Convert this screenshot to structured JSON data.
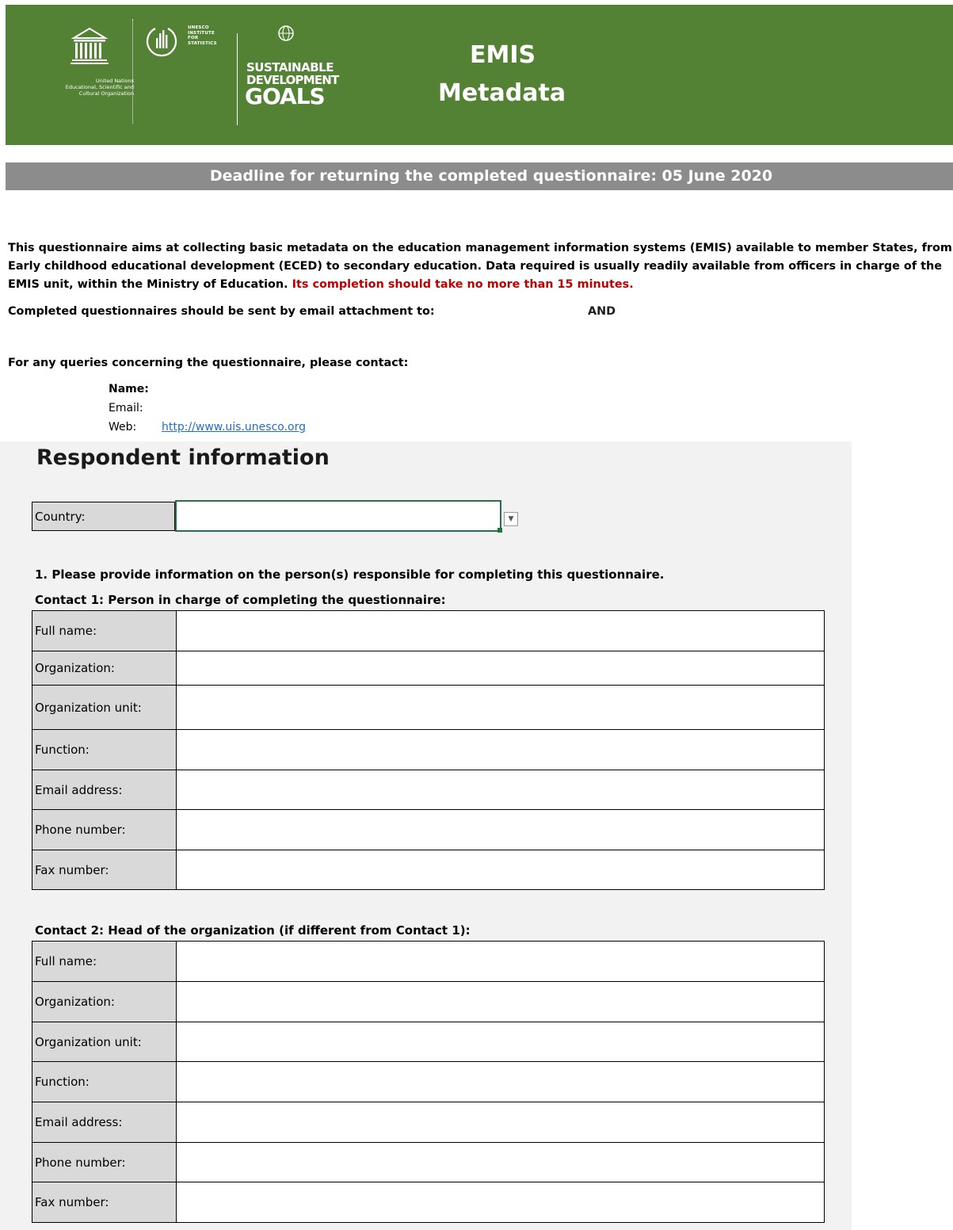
{
  "header": {
    "unesco_org_text": [
      "United Nations",
      "Educational, Scientific and",
      "Cultural Organization"
    ],
    "uis_text": [
      "UNESCO",
      "INSTITUTE",
      "FOR",
      "STATISTICS"
    ],
    "sdg_text": [
      "SUSTAINABLE",
      "DEVELOPMENT",
      "GOALS"
    ],
    "title_line1": "EMIS",
    "title_line2": "Metadata",
    "brand_color": "#548235"
  },
  "deadline": {
    "text": "Deadline for returning the completed questionnaire: 05 June 2020",
    "bar_color": "#8c8c8c"
  },
  "intro": {
    "line1": "This questionnaire aims at collecting basic metadata on the education management information systems (EMIS) available to member States, from",
    "line2": "Early childhood educational development (ECED) to secondary education. Data required is usually readily available from officers in charge of the",
    "line3": "EMIS unit, within the Ministry of Education. ",
    "line3_red": "Its completion should take no more than 15 minutes.",
    "red_color": "#c00000"
  },
  "email_instruction": "Completed questionnaires should be sent by email attachment to:",
  "email_and": "AND",
  "queries_instruction": "For any queries concerning the questionnaire, please contact:",
  "contact_info": {
    "name_label": "Name:",
    "email_label": "Email:",
    "web_label": "Web:",
    "web_url": "http://www.uis.unesco.org"
  },
  "respondent": {
    "section_title": "Respondent information",
    "country_label": "Country:",
    "country_value": "",
    "question1": "1. Please provide information on the person(s) responsible for completing this questionnaire.",
    "contact1_title": "Contact 1: Person in charge of completing the questionnaire:",
    "contact2_title": "Contact 2: Head of the organization (if different from Contact 1):",
    "fields": [
      "Full name:",
      "Organization:",
      "Organization unit:",
      "Function:",
      "Email address:",
      "Phone number:",
      "Fax number:"
    ]
  }
}
